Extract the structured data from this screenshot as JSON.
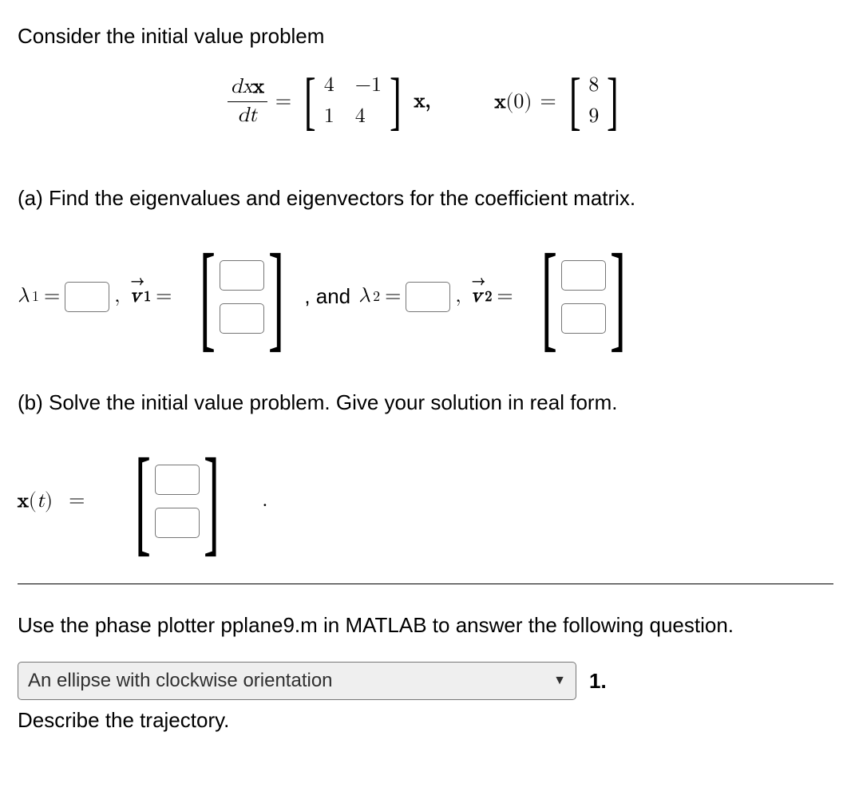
{
  "intro": "Consider the initial value problem",
  "equation": {
    "lhs_num": "dx",
    "lhs_den": "dt",
    "eq": "=",
    "matrix": {
      "a11": "4",
      "a12": "−1",
      "a21": "1",
      "a22": "4"
    },
    "xcomma": "x,",
    "ic_lhs": "x(0)",
    "ic_eq": "=",
    "ic_vec": {
      "r1": "8",
      "r2": "9"
    }
  },
  "partA": {
    "prompt": "(a) Find the eigenvalues and eigenvectors for the coefficient matrix.",
    "lambda1": "λ",
    "lambda1sub": "1",
    "eq": "=",
    "v1": "v",
    "v1arrow": "→",
    "v1sub": "1",
    "and": ", and",
    "lambda2": "λ",
    "lambda2sub": "2",
    "v2": "v",
    "v2sub": "2"
  },
  "partB": {
    "prompt": "(b) Solve the initial value problem. Give your solution in real form.",
    "xt": "x(t)",
    "eq": "=",
    "period": "."
  },
  "bottom": {
    "instruction": "Use the phase plotter pplane9.m in MATLAB to answer the following question.",
    "select_value": "An ellipse with clockwise orientation",
    "label_after": "1.",
    "describe": "Describe the trajectory."
  }
}
